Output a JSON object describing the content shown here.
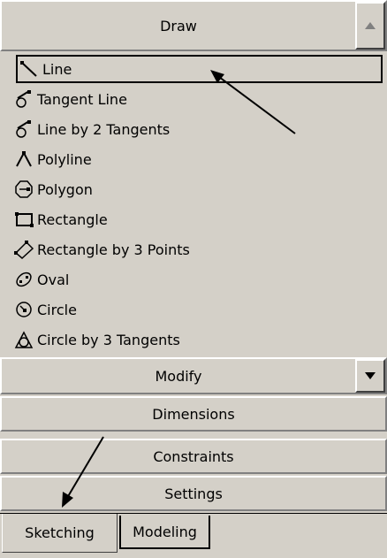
{
  "draw_header": {
    "label": "Draw",
    "scroll_icon": "triangle-up-icon"
  },
  "draw_items": [
    {
      "label": "Line",
      "icon": "line-icon",
      "selected": true
    },
    {
      "label": "Tangent Line",
      "icon": "tangent-line-icon"
    },
    {
      "label": "Line by 2 Tangents",
      "icon": "line-by-2-tangents-icon"
    },
    {
      "label": "Polyline",
      "icon": "polyline-icon"
    },
    {
      "label": "Polygon",
      "icon": "polygon-icon"
    },
    {
      "label": "Rectangle",
      "icon": "rectangle-icon"
    },
    {
      "label": "Rectangle by 3 Points",
      "icon": "rectangle-3-points-icon"
    },
    {
      "label": "Oval",
      "icon": "oval-icon"
    },
    {
      "label": "Circle",
      "icon": "circle-icon"
    },
    {
      "label": "Circle by 3 Tangents",
      "icon": "circle-3-tangents-icon"
    }
  ],
  "sections": [
    {
      "label": "Modify",
      "scroll_icon": "triangle-down-icon"
    },
    {
      "label": "Dimensions"
    },
    {
      "label": "Constraints"
    },
    {
      "label": "Settings"
    }
  ],
  "tabs": [
    {
      "label": "Sketching",
      "active": true
    },
    {
      "label": "Modeling",
      "active": false
    }
  ]
}
